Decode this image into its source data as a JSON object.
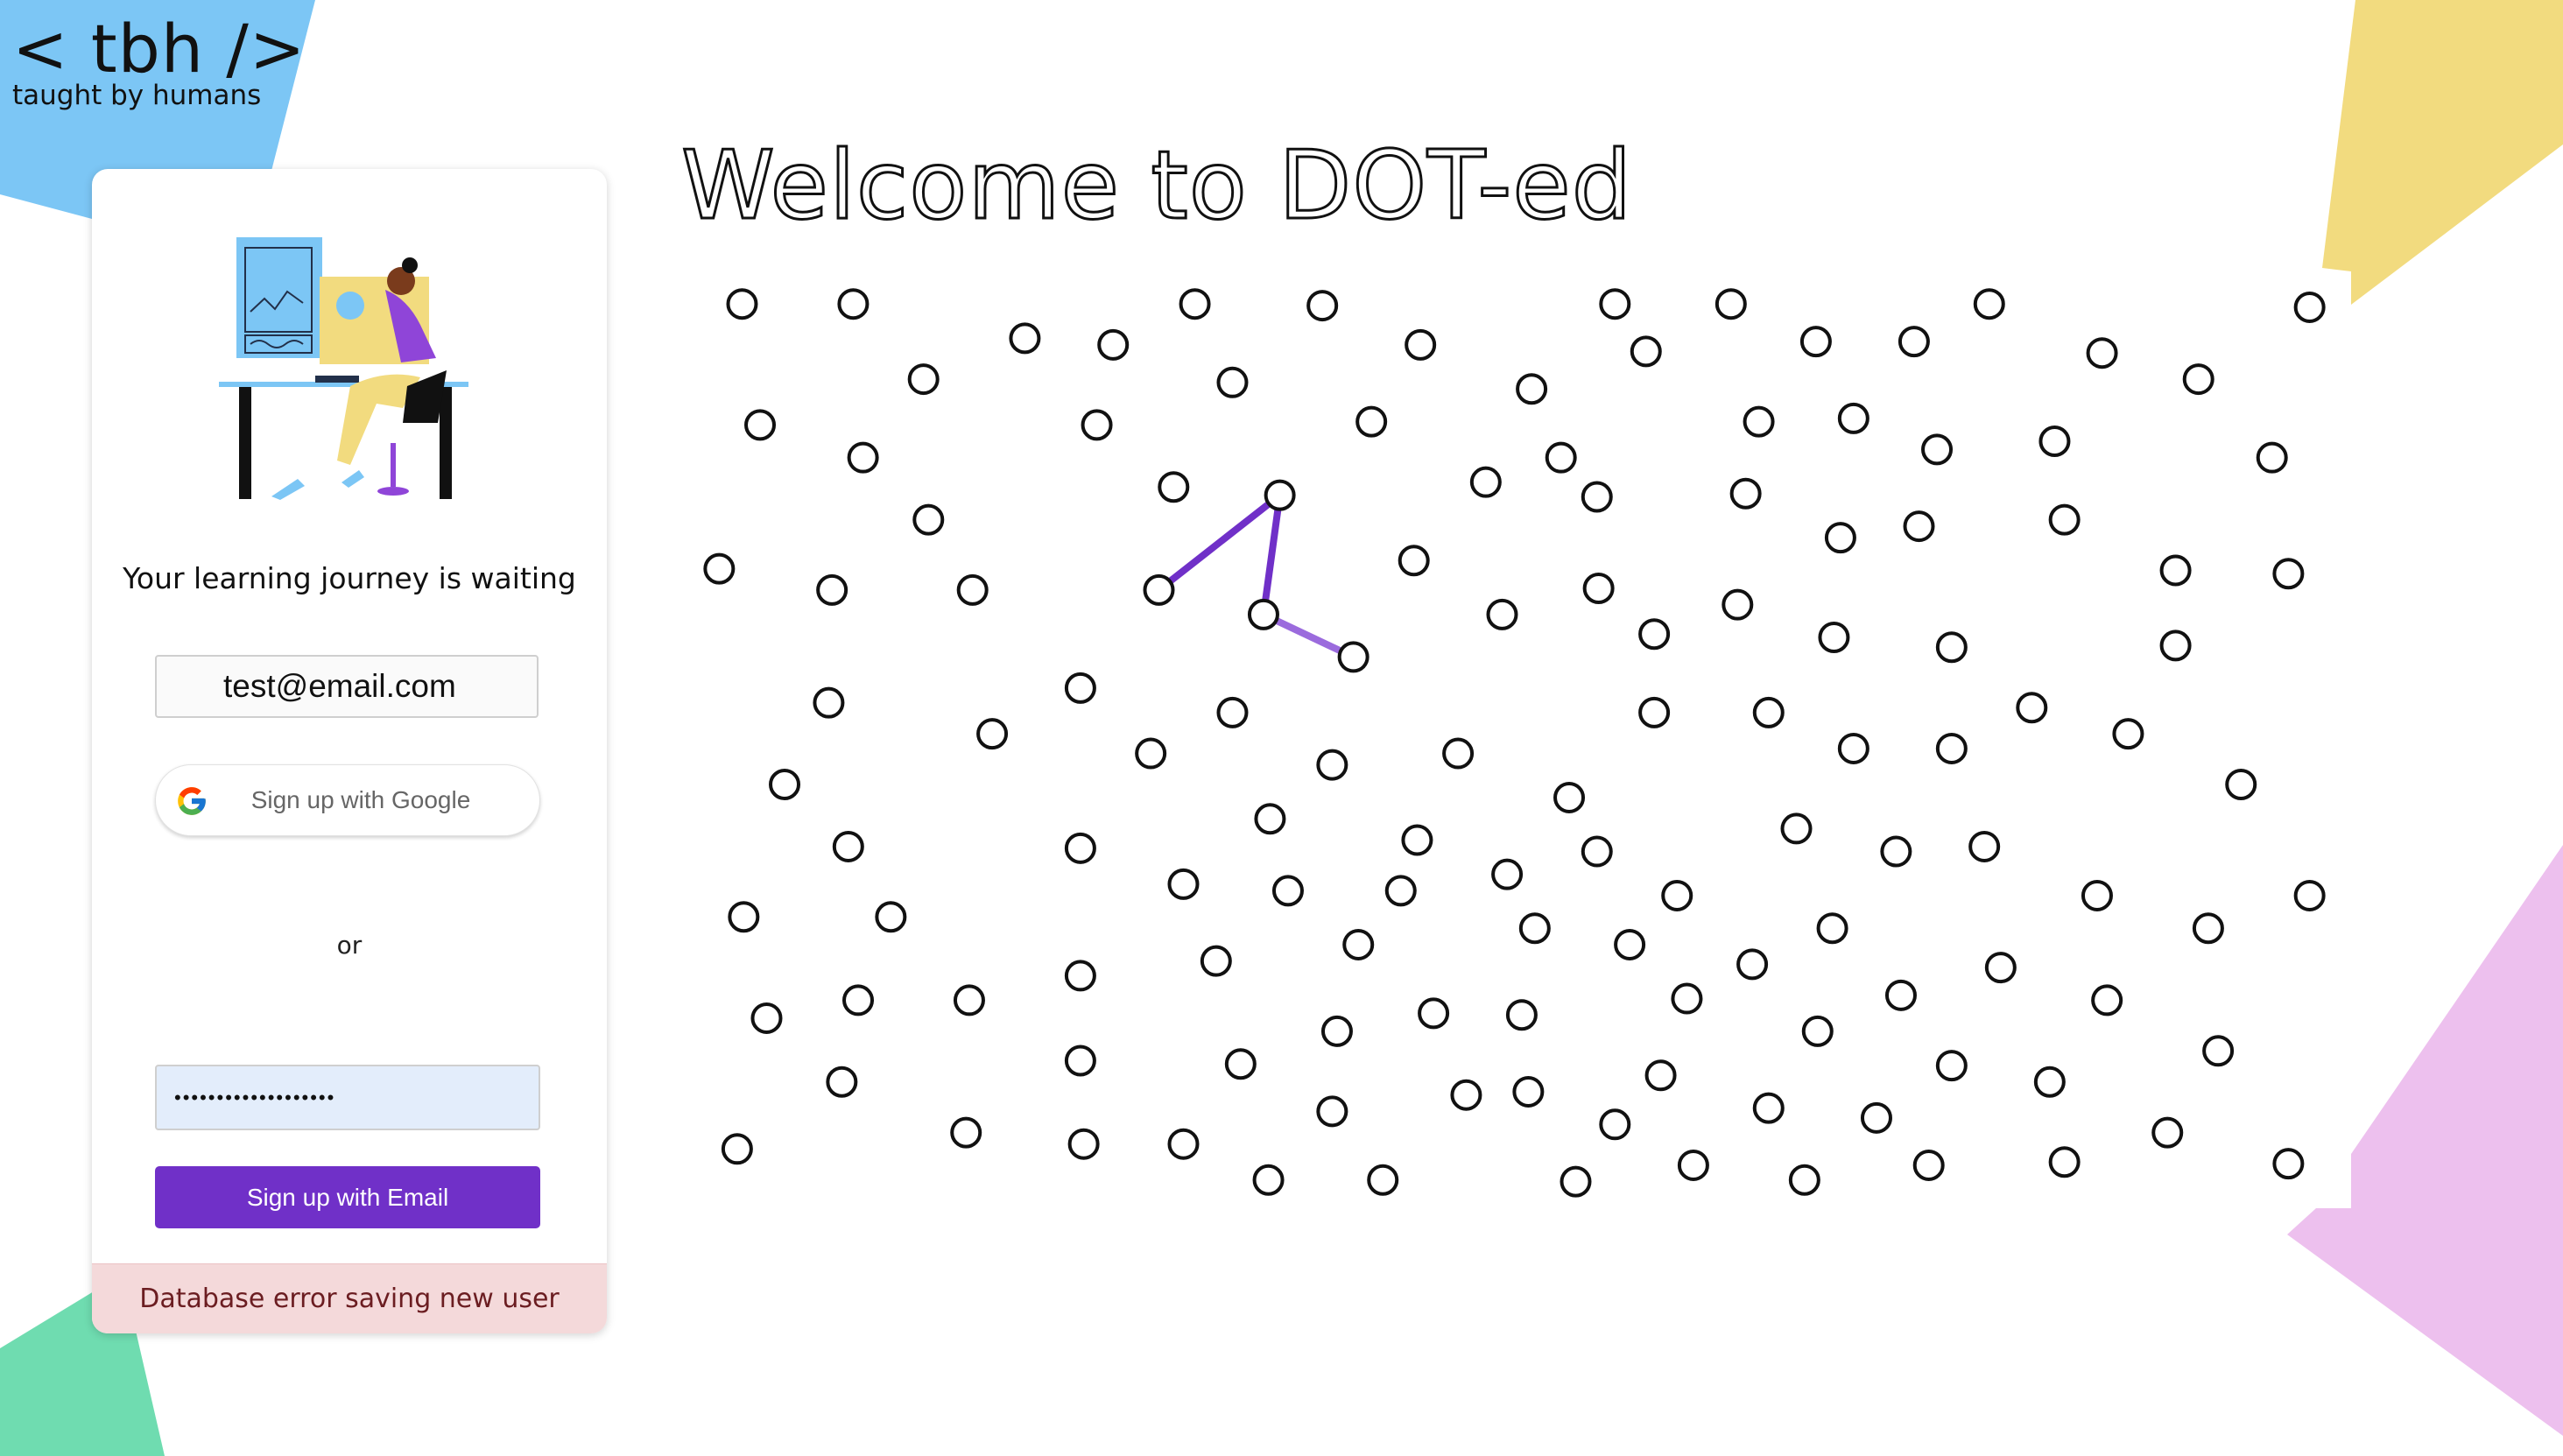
{
  "brand": {
    "logo_text": "< tbh />",
    "logo_subtitle": "taught by humans"
  },
  "colors": {
    "blue_shape": "#7cc6f5",
    "yellow_shape": "#f2db7f",
    "green_shape": "#6fdcb0",
    "pink_shape": "#edc0ee",
    "accent_purple": "#7030c8",
    "error_background": "#f4d9da",
    "error_text": "#6b1d21"
  },
  "signup": {
    "illustration": "person-at-desk-illustration",
    "tagline": "Your learning journey is waiting",
    "email_value": "test@email.com",
    "google_label": "Sign up with Google",
    "google_icon": "google-g-icon",
    "or_label": "or",
    "password_value": "•••••••••••••••••••",
    "email_button_label": "Sign up with Email",
    "error_message": "Database error saving new user"
  },
  "game": {
    "title": "Welcome to DOT-ed",
    "dot_count": 136,
    "connected_lines": 3
  }
}
